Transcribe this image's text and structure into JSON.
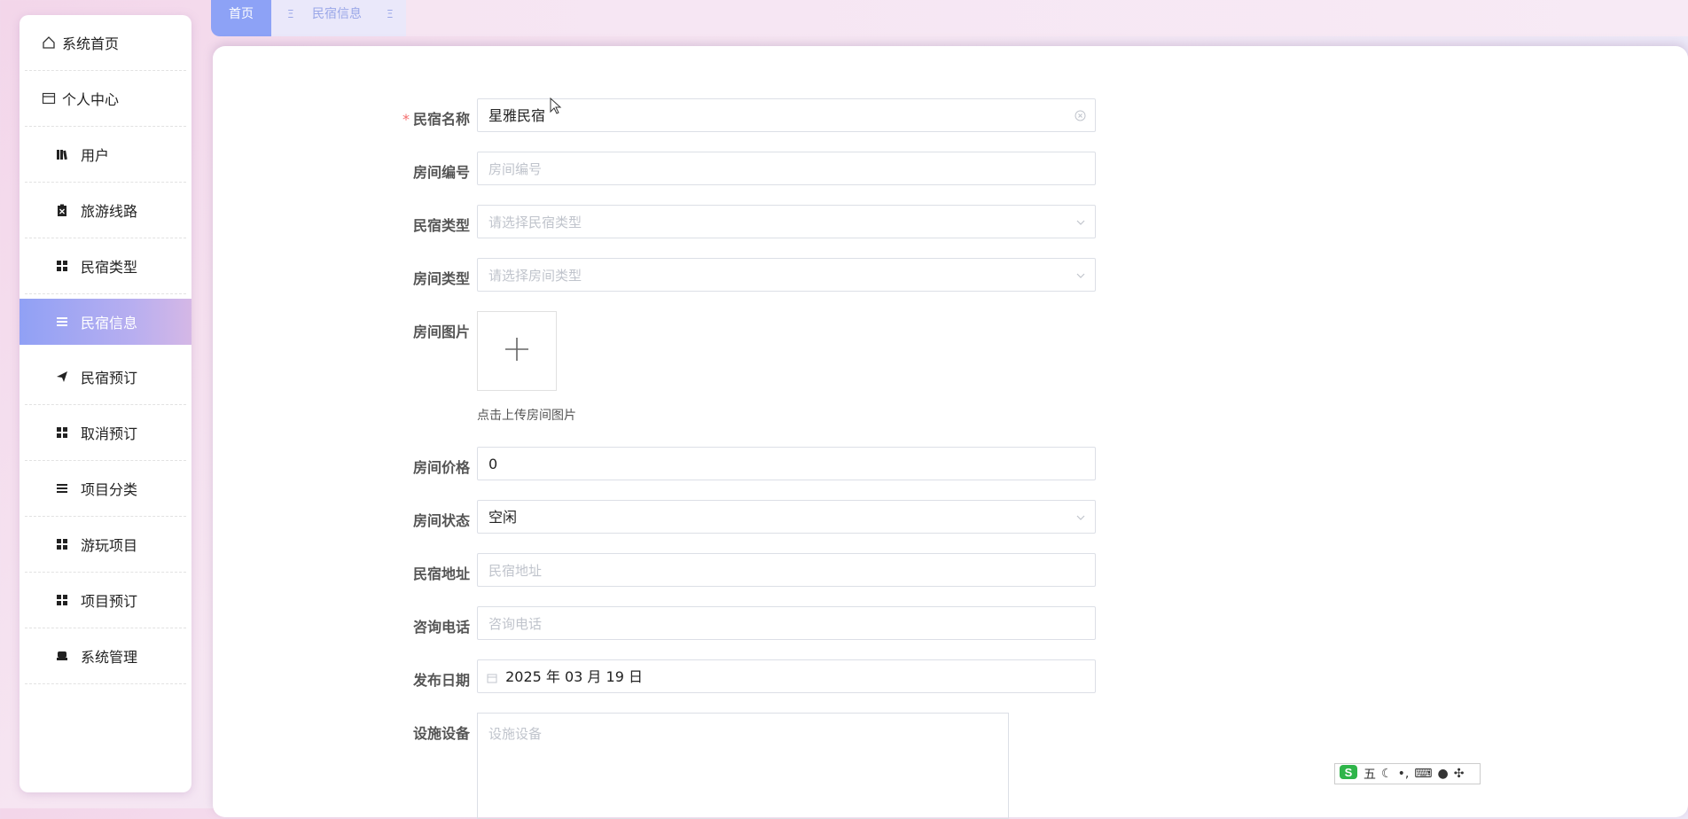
{
  "sidebar": {
    "items": [
      {
        "label": "系统首页",
        "icon": "home-icon"
      },
      {
        "label": "个人中心",
        "icon": "profile-card-icon"
      },
      {
        "label": "用户",
        "icon": "library-icon"
      },
      {
        "label": "旅游线路",
        "icon": "clipboard-icon"
      },
      {
        "label": "民宿类型",
        "icon": "grid-icon"
      },
      {
        "label": "民宿信息",
        "icon": "list-icon"
      },
      {
        "label": "民宿预订",
        "icon": "send-icon"
      },
      {
        "label": "取消预订",
        "icon": "grid-icon"
      },
      {
        "label": "项目分类",
        "icon": "list-icon"
      },
      {
        "label": "游玩项目",
        "icon": "grid-icon"
      },
      {
        "label": "项目预订",
        "icon": "grid-icon"
      },
      {
        "label": "系统管理",
        "icon": "archive-icon"
      }
    ],
    "active_index": 5
  },
  "tabs": {
    "home": "首页",
    "current": "民宿信息"
  },
  "form": {
    "name": {
      "label": "民宿名称",
      "value": "星雅民宿",
      "required": true
    },
    "room_no": {
      "label": "房间编号",
      "placeholder": "房间编号"
    },
    "homestay_type": {
      "label": "民宿类型",
      "placeholder": "请选择民宿类型"
    },
    "room_type": {
      "label": "房间类型",
      "placeholder": "请选择房间类型"
    },
    "room_image": {
      "label": "房间图片",
      "tip": "点击上传房间图片"
    },
    "price": {
      "label": "房间价格",
      "value": "0"
    },
    "status": {
      "label": "房间状态",
      "value": "空闲"
    },
    "address": {
      "label": "民宿地址",
      "placeholder": "民宿地址"
    },
    "phone": {
      "label": "咨询电话",
      "placeholder": "咨询电话"
    },
    "publish_date": {
      "label": "发布日期",
      "value": "2025 年 03 月 19 日"
    },
    "facilities": {
      "label": "设施设备",
      "placeholder": "设施设备"
    }
  },
  "ime": {
    "label": "五"
  },
  "colors": {
    "accent": "#8da2f6",
    "required": "#f56c6c"
  }
}
